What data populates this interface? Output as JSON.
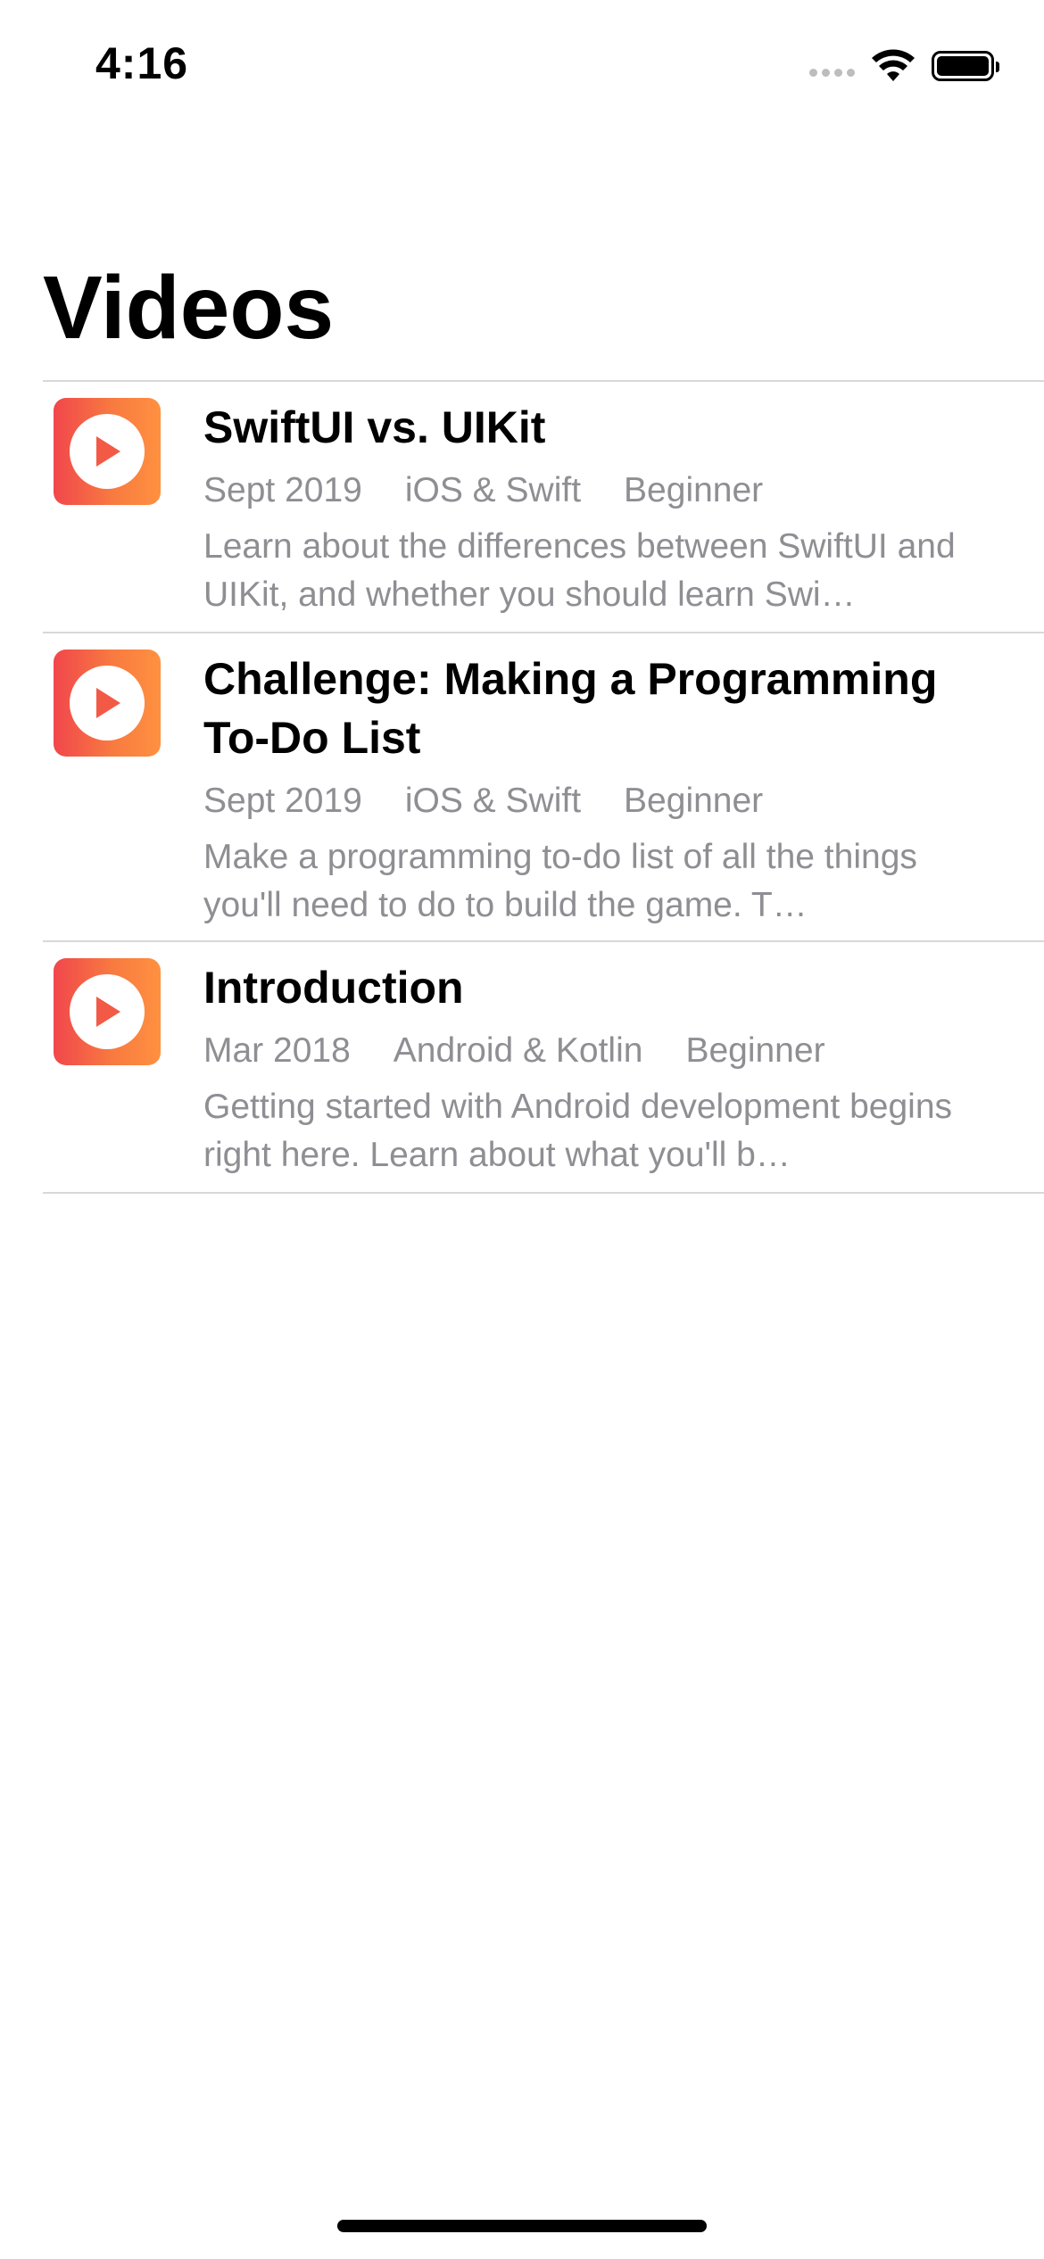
{
  "status_bar": {
    "time": "4:16",
    "icons": [
      "cellular-signal-icon",
      "wifi-icon",
      "battery-icon"
    ]
  },
  "page": {
    "title": "Videos"
  },
  "theme": {
    "thumb_gradient_start": "#f1464c",
    "thumb_gradient_end": "#ff9140",
    "meta_color": "#8e8e93",
    "divider_color": "#d8d8dc"
  },
  "videos": [
    {
      "title": "SwiftUI vs. UIKit",
      "date": "Sept 2019",
      "domain": "iOS & Swift",
      "difficulty": "Beginner",
      "description": "Learn about the differences between SwiftUI and UIKit, and whether you should learn Swi…",
      "icon": "play-icon"
    },
    {
      "title": "Challenge: Making a Programming To-Do List",
      "date": "Sept 2019",
      "domain": "iOS & Swift",
      "difficulty": "Beginner",
      "description": "Make a programming to-do list of all the things you'll need to do to build the game. T…",
      "icon": "play-icon"
    },
    {
      "title": "Introduction",
      "date": "Mar 2018",
      "domain": "Android & Kotlin",
      "difficulty": "Beginner",
      "description": "Getting started with Android development begins right here. Learn about what you'll b…",
      "icon": "play-icon"
    }
  ]
}
